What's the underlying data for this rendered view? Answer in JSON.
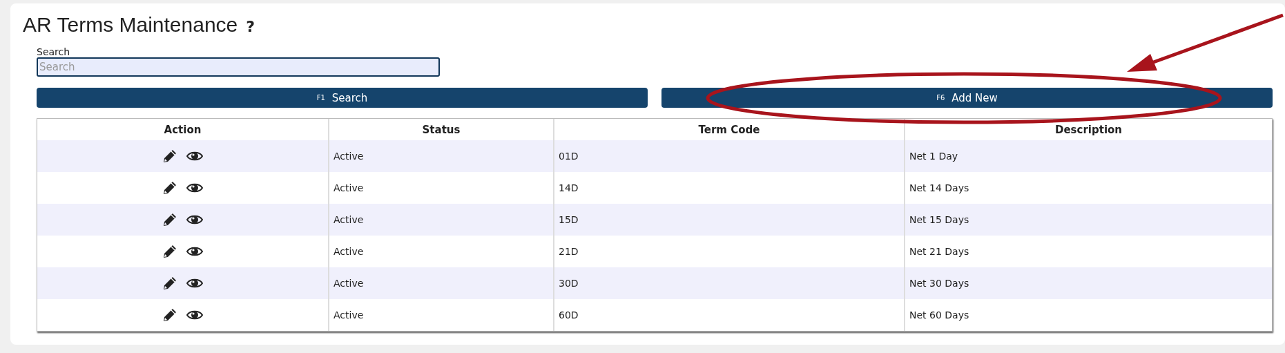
{
  "page": {
    "title": "AR Terms Maintenance",
    "help": "?"
  },
  "search": {
    "label": "Search",
    "placeholder": "Search"
  },
  "buttons": [
    {
      "key": "F1",
      "label": "Search"
    },
    {
      "key": "F6",
      "label": "Add New"
    }
  ],
  "table": {
    "columns": [
      "Action",
      "Status",
      "Term Code",
      "Description"
    ],
    "rows": [
      {
        "status": "Active",
        "term_code": "01D",
        "description": "Net 1 Day"
      },
      {
        "status": "Active",
        "term_code": "14D",
        "description": "Net 14 Days"
      },
      {
        "status": "Active",
        "term_code": "15D",
        "description": "Net 15 Days"
      },
      {
        "status": "Active",
        "term_code": "21D",
        "description": "Net 21 Days"
      },
      {
        "status": "Active",
        "term_code": "30D",
        "description": "Net 30 Days"
      },
      {
        "status": "Active",
        "term_code": "60D",
        "description": "Net 60 Days"
      }
    ]
  }
}
